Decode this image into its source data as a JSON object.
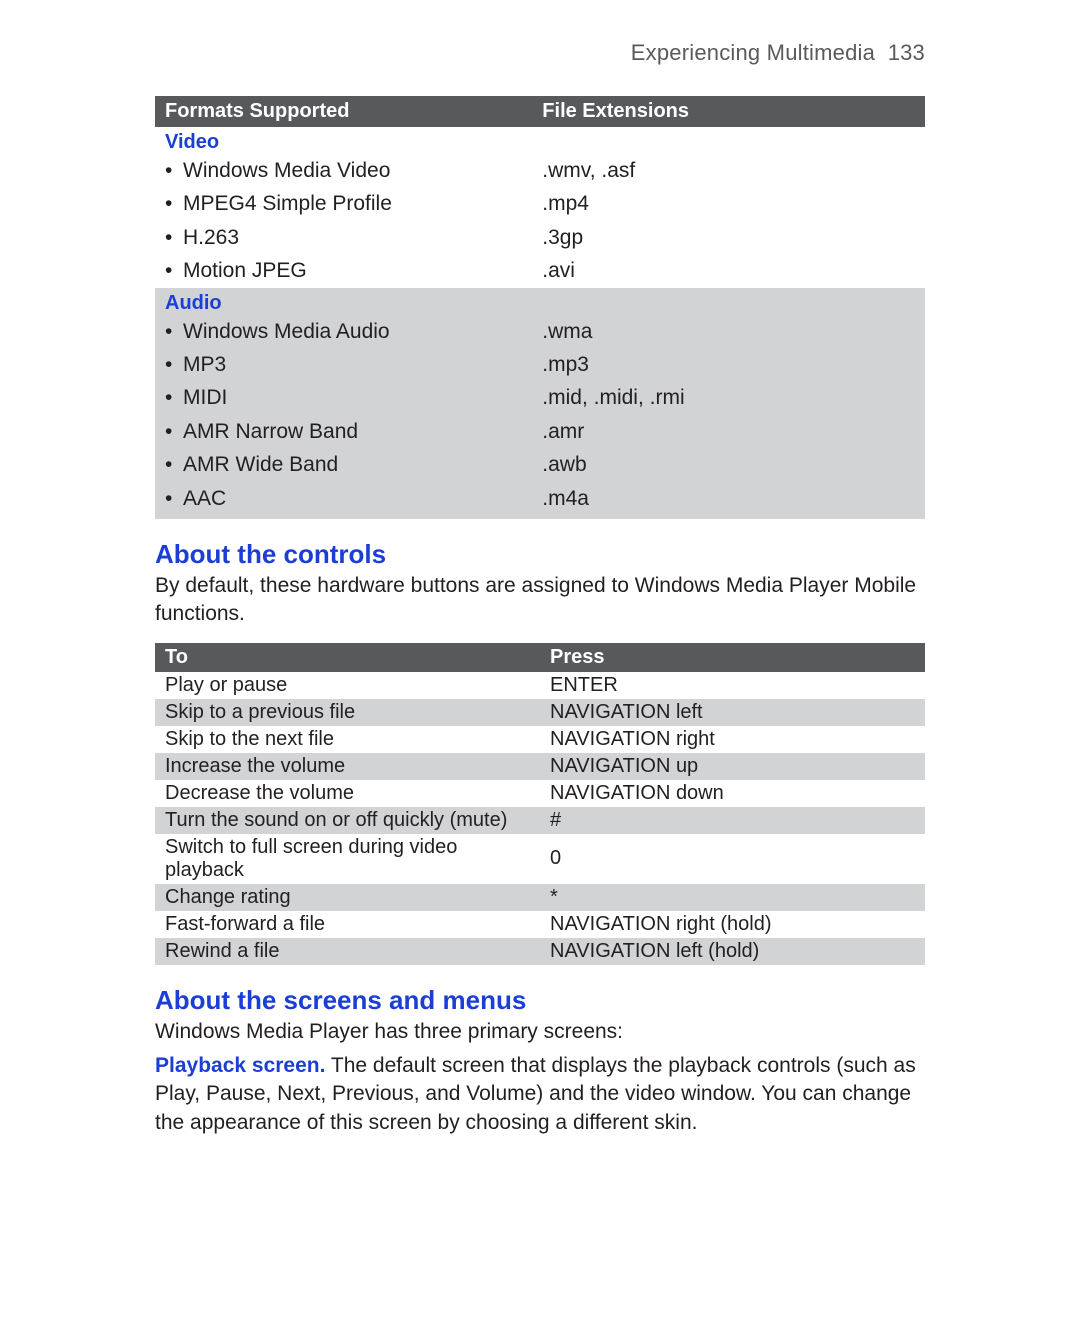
{
  "header": {
    "chapter": "Experiencing Multimedia",
    "page_number": "133"
  },
  "formats_table": {
    "columns": {
      "formats": "Formats Supported",
      "extensions": "File Extensions"
    },
    "video_heading": "Video",
    "video_rows": [
      {
        "name": "Windows Media Video",
        "ext": ".wmv, .asf"
      },
      {
        "name": "MPEG4 Simple Profile",
        "ext": ".mp4"
      },
      {
        "name": "H.263",
        "ext": ".3gp"
      },
      {
        "name": "Motion JPEG",
        "ext": ".avi"
      }
    ],
    "audio_heading": "Audio",
    "audio_rows": [
      {
        "name": "Windows Media Audio",
        "ext": ".wma"
      },
      {
        "name": "MP3",
        "ext": ".mp3"
      },
      {
        "name": "MIDI",
        "ext": ".mid, .midi, .rmi"
      },
      {
        "name": "AMR Narrow Band",
        "ext": ".amr"
      },
      {
        "name": "AMR Wide Band",
        "ext": ".awb"
      },
      {
        "name": "AAC",
        "ext": ".m4a"
      }
    ]
  },
  "about_controls": {
    "heading": "About the controls",
    "intro": "By default, these hardware buttons are assigned to Windows Media Player Mobile functions.",
    "columns": {
      "to": "To",
      "press": "Press"
    },
    "rows": [
      {
        "to": "Play or pause",
        "press": "ENTER"
      },
      {
        "to": "Skip to a previous file",
        "press": "NAVIGATION left"
      },
      {
        "to": "Skip to the next file",
        "press": "NAVIGATION right"
      },
      {
        "to": "Increase the volume",
        "press": "NAVIGATION up"
      },
      {
        "to": "Decrease the volume",
        "press": "NAVIGATION down"
      },
      {
        "to": "Turn the sound on or off quickly (mute)",
        "press": "#"
      },
      {
        "to": "Switch to full screen during video playback",
        "press": "0"
      },
      {
        "to": "Change rating",
        "press": "*"
      },
      {
        "to": "Fast-forward a file",
        "press": "NAVIGATION right (hold)"
      },
      {
        "to": "Rewind a file",
        "press": "NAVIGATION left (hold)"
      }
    ]
  },
  "about_screens": {
    "heading": "About the screens and menus",
    "intro": "Windows Media Player has three primary screens:",
    "playback_lead": "Playback screen.",
    "playback_text": " The default screen that displays the playback controls (such as Play, Pause, Next, Previous, and Volume) and the video window. You can change the appearance of this screen by choosing a different skin."
  }
}
